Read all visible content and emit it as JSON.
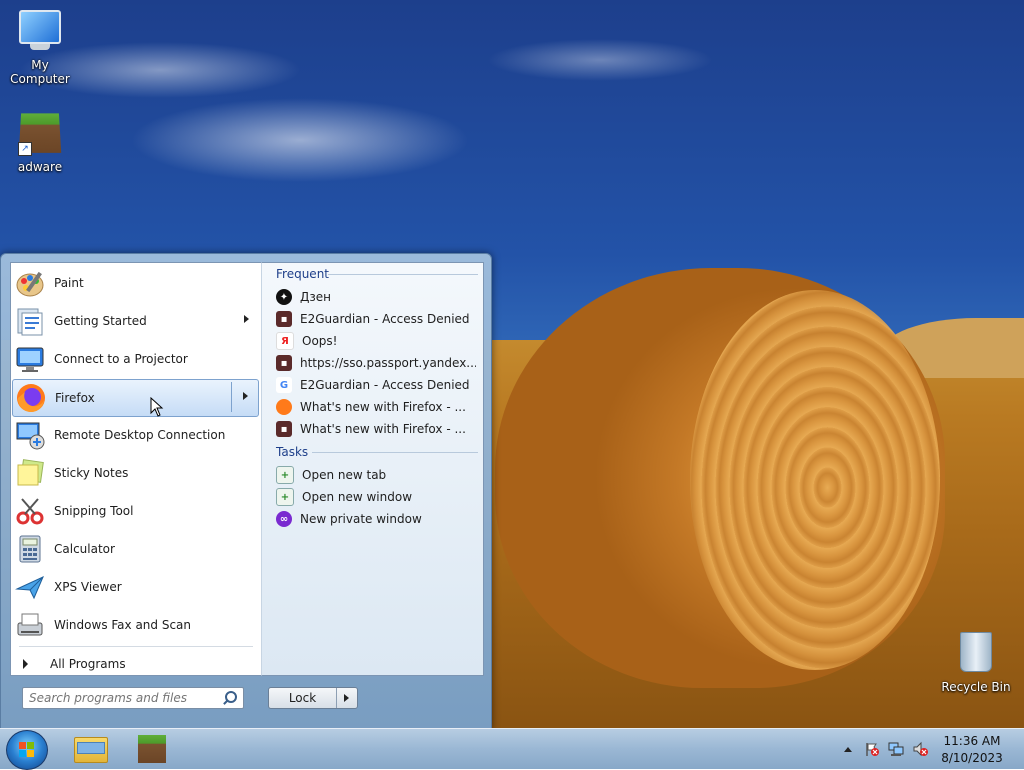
{
  "desktop": {
    "icons": [
      {
        "label": "My Computer",
        "icon": "computer-icon"
      },
      {
        "label": "adware",
        "icon": "minecraft-block-icon"
      },
      {
        "label": "Recycle Bin",
        "icon": "recycle-bin-icon"
      }
    ]
  },
  "start_menu": {
    "programs": [
      {
        "label": "Paint",
        "icon": "paint-icon",
        "has_submenu": false
      },
      {
        "label": "Getting Started",
        "icon": "getting-started-icon",
        "has_submenu": true
      },
      {
        "label": "Connect to a Projector",
        "icon": "projector-icon",
        "has_submenu": false
      },
      {
        "label": "Firefox",
        "icon": "firefox-icon",
        "has_submenu": true,
        "highlighted": true
      },
      {
        "label": "Remote Desktop Connection",
        "icon": "remote-desktop-icon",
        "has_submenu": false
      },
      {
        "label": "Sticky Notes",
        "icon": "sticky-notes-icon",
        "has_submenu": false
      },
      {
        "label": "Snipping Tool",
        "icon": "snipping-tool-icon",
        "has_submenu": false
      },
      {
        "label": "Calculator",
        "icon": "calculator-icon",
        "has_submenu": false
      },
      {
        "label": "XPS Viewer",
        "icon": "xps-viewer-icon",
        "has_submenu": false
      },
      {
        "label": "Windows Fax and Scan",
        "icon": "fax-scan-icon",
        "has_submenu": false
      }
    ],
    "all_programs": "All Programs",
    "jumplist": {
      "frequent_header": "Frequent",
      "frequent": [
        {
          "label": "Дзен",
          "icon": "dzen-icon"
        },
        {
          "label": "E2Guardian - Access Denied",
          "icon": "page-icon"
        },
        {
          "label": "Oops!",
          "icon": "yandex-icon"
        },
        {
          "label": "https://sso.passport.yandex...",
          "icon": "page-icon"
        },
        {
          "label": "E2Guardian - Access Denied",
          "icon": "google-icon"
        },
        {
          "label": "What's new with Firefox - ...",
          "icon": "firefox-icon"
        },
        {
          "label": "What's new with Firefox - ...",
          "icon": "page-icon"
        }
      ],
      "tasks_header": "Tasks",
      "tasks": [
        {
          "label": "Open new tab",
          "icon": "new-tab-icon"
        },
        {
          "label": "Open new window",
          "icon": "new-window-icon"
        },
        {
          "label": "New private window",
          "icon": "private-window-icon"
        }
      ]
    },
    "search": {
      "placeholder": "Search programs and files",
      "value": ""
    },
    "power_button": "Lock"
  },
  "taskbar": {
    "pinned": [
      {
        "name": "explorer",
        "icon": "folder-icon"
      },
      {
        "name": "minecraft",
        "icon": "minecraft-block-icon"
      }
    ],
    "clock": {
      "time": "11:36 AM",
      "date": "8/10/2023"
    }
  },
  "colors": {
    "accent": "#1e3f8a",
    "highlight": "#c6dcf6",
    "taskbar": "#9ab7d4"
  }
}
